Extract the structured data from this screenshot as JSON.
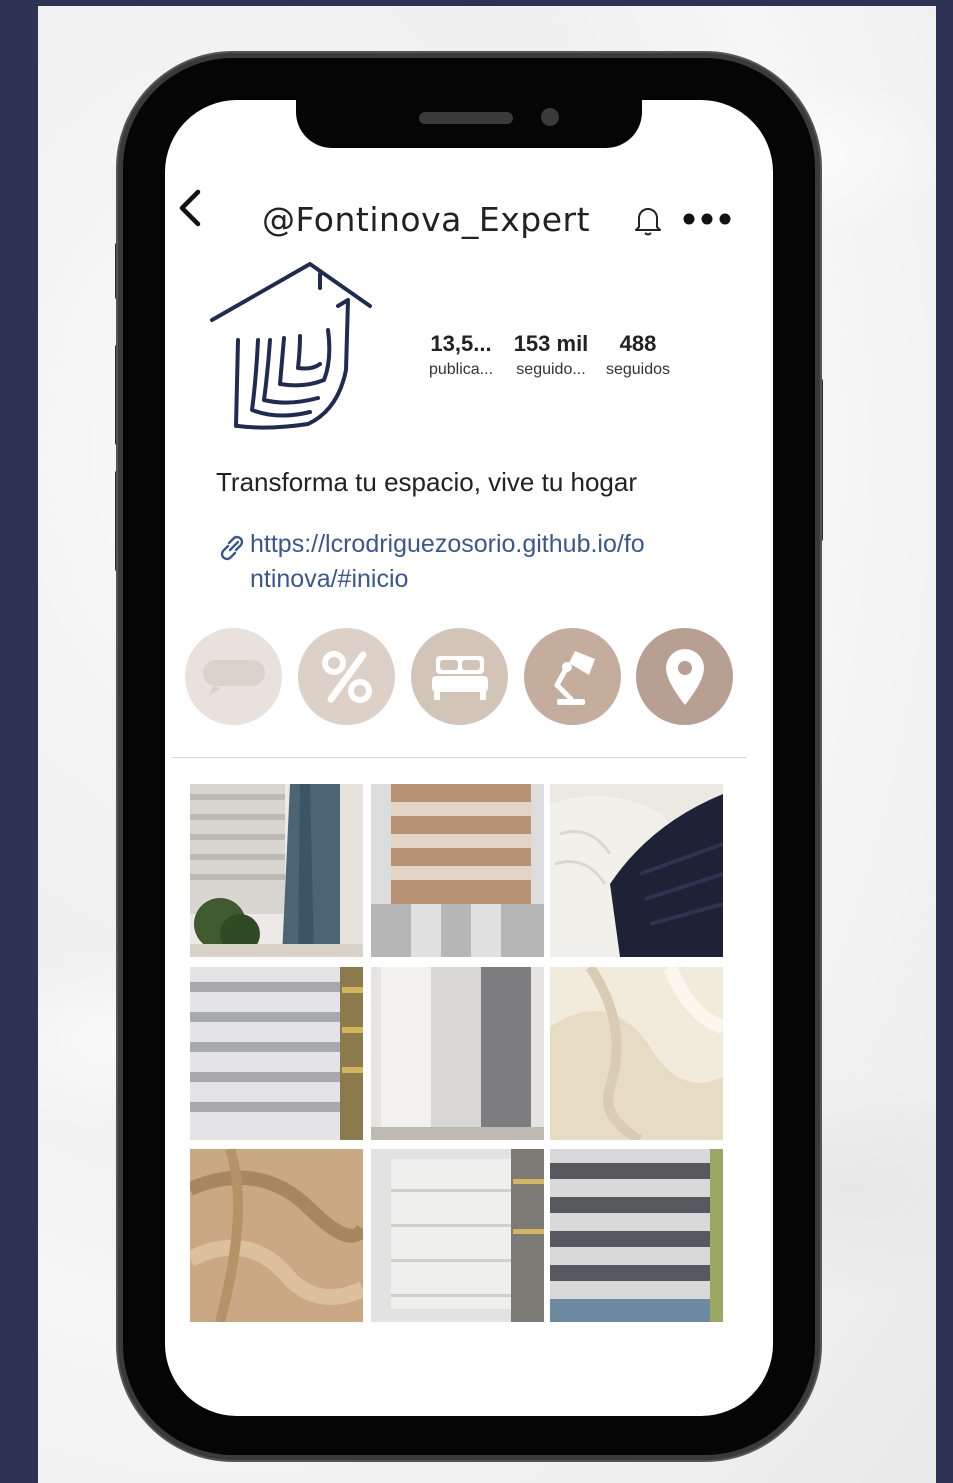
{
  "profile": {
    "handle": "@Fontinova_Expert",
    "bio": "Transforma tu espacio, vive tu hogar",
    "link": "https://lcrodriguezosorio.github.io/fontinova/#inicio"
  },
  "stats": [
    {
      "value": "13,5...",
      "label": "publica..."
    },
    {
      "value": "153 mil",
      "label": "seguido..."
    },
    {
      "value": "488",
      "label": "seguidos"
    }
  ],
  "icons": {
    "back": "chevron-left-icon",
    "bell": "bell-icon",
    "more": "more-horizontal-icon",
    "link": "link-icon"
  },
  "highlights": [
    {
      "icon": "sofa-icon",
      "color": "#e9e1dc"
    },
    {
      "icon": "percent-icon",
      "color": "#ddd1c7"
    },
    {
      "icon": "bed-icon",
      "color": "#d3c4b8"
    },
    {
      "icon": "desk-lamp-icon",
      "color": "#c4ad9d"
    },
    {
      "icon": "location-pin-icon",
      "color": "#b7a091"
    }
  ],
  "colors": {
    "background": "#2c3354",
    "link": "#3a5791",
    "logo": "#1f2b52"
  },
  "posts": [
    {
      "subject": "zebra blinds and teal curtain"
    },
    {
      "subject": "brown striped roller blind"
    },
    {
      "subject": "white and navy knit blankets"
    },
    {
      "subject": "grey layered blinds"
    },
    {
      "subject": "white and grey panel curtains"
    },
    {
      "subject": "cream satin fabric"
    },
    {
      "subject": "tan textured fabric"
    },
    {
      "subject": "white patterned blind"
    },
    {
      "subject": "grey and white zebra blind"
    }
  ]
}
